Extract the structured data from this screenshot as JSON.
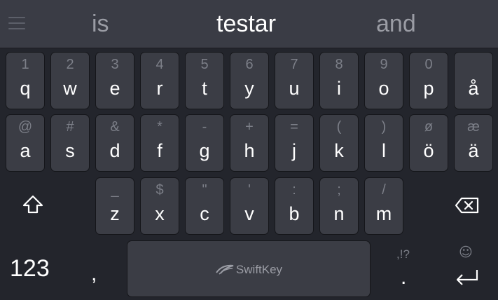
{
  "suggestions": {
    "left": "is",
    "center": "testar",
    "right": "and"
  },
  "rows": [
    [
      {
        "hint": "1",
        "label": "q"
      },
      {
        "hint": "2",
        "label": "w"
      },
      {
        "hint": "3",
        "label": "e"
      },
      {
        "hint": "4",
        "label": "r"
      },
      {
        "hint": "5",
        "label": "t"
      },
      {
        "hint": "6",
        "label": "y"
      },
      {
        "hint": "7",
        "label": "u"
      },
      {
        "hint": "8",
        "label": "i"
      },
      {
        "hint": "9",
        "label": "o"
      },
      {
        "hint": "0",
        "label": "p"
      },
      {
        "hint": "",
        "label": "å"
      }
    ],
    [
      {
        "hint": "@",
        "label": "a"
      },
      {
        "hint": "#",
        "label": "s"
      },
      {
        "hint": "&",
        "label": "d"
      },
      {
        "hint": "*",
        "label": "f"
      },
      {
        "hint": "-",
        "label": "g"
      },
      {
        "hint": "+",
        "label": "h"
      },
      {
        "hint": "=",
        "label": "j"
      },
      {
        "hint": "(",
        "label": "k"
      },
      {
        "hint": ")",
        "label": "l"
      },
      {
        "hint": "ø",
        "label": "ö"
      },
      {
        "hint": "æ",
        "label": "ä"
      }
    ],
    [
      {
        "hint": "_",
        "label": "z"
      },
      {
        "hint": "$",
        "label": "x"
      },
      {
        "hint": "\"",
        "label": "c"
      },
      {
        "hint": "'",
        "label": "v"
      },
      {
        "hint": ":",
        "label": "b"
      },
      {
        "hint": ";",
        "label": "n"
      },
      {
        "hint": "/",
        "label": "m"
      }
    ]
  ],
  "bottom": {
    "numbers_label": "123",
    "comma_label": ",",
    "space_brand": "SwiftKey",
    "punct_hint": ",!?",
    "period_label": ".",
    "emoji_hint": "☺"
  },
  "icons": {
    "shift": "shift-icon",
    "backspace": "backspace-icon",
    "enter": "enter-icon",
    "menu": "menu-icon"
  }
}
